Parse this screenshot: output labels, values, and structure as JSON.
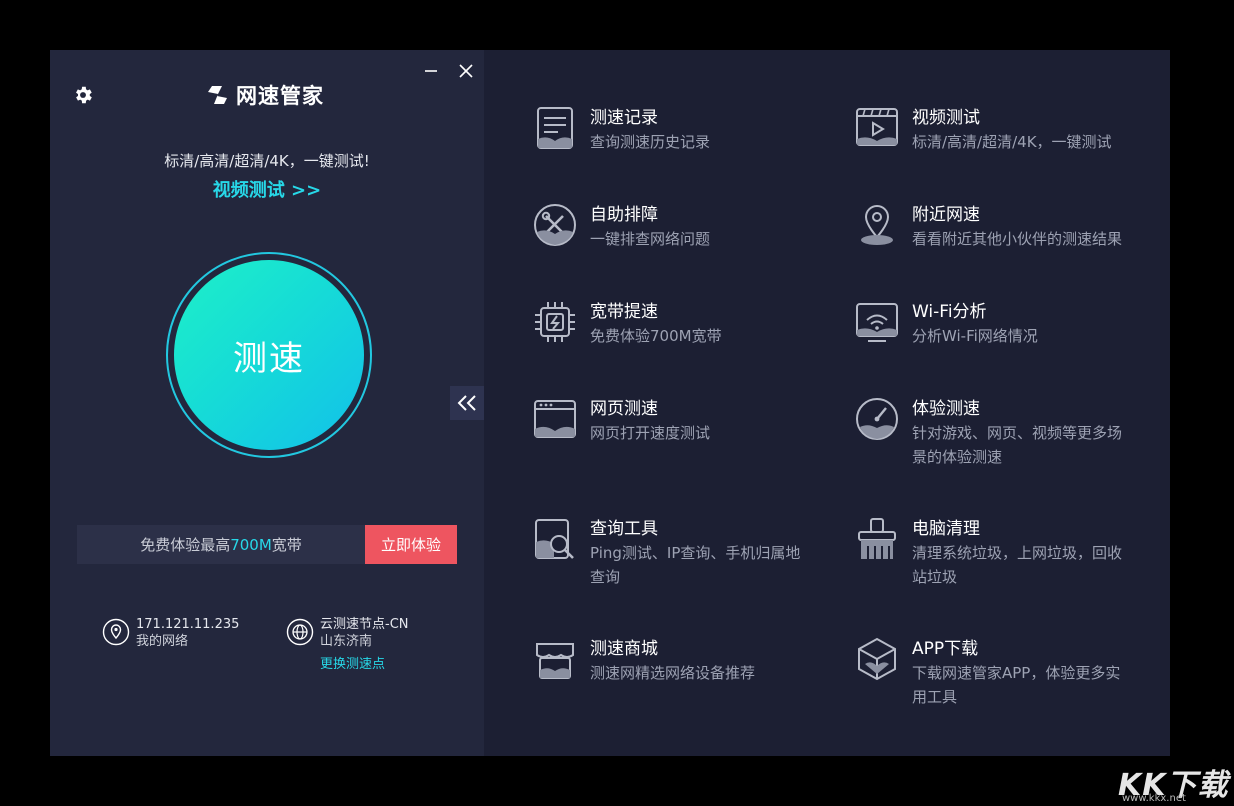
{
  "app": {
    "title": "网速管家"
  },
  "left": {
    "promo_line": "标清/高清/超清/4K，一键测试!",
    "promo_link": "视频测试 >>",
    "speed_button": "测速",
    "broadband": {
      "text_before": "免费体验最高",
      "text_highlight": "700M",
      "text_after": "宽带",
      "button": "立即体验"
    },
    "network": {
      "ip": "171.121.11.235",
      "label": "我的网络"
    },
    "node": {
      "name": "云测速节点-CN",
      "location": "山东济南",
      "change_link": "更换测速点"
    }
  },
  "features": [
    {
      "title": "测速记录",
      "desc": "查询测速历史记录",
      "icon": "record-icon"
    },
    {
      "title": "视频测试",
      "desc": "标清/高清/超清/4K，一键测试",
      "icon": "video-icon"
    },
    {
      "title": "自助排障",
      "desc": "一键排查网络问题",
      "icon": "repair-icon"
    },
    {
      "title": "附近网速",
      "desc": "看看附近其他小伙伴的测速结果",
      "icon": "location-icon"
    },
    {
      "title": "宽带提速",
      "desc": "免费体验700M宽带",
      "icon": "chip-icon"
    },
    {
      "title": "Wi-Fi分析",
      "desc": "分析Wi-Fi网络情况",
      "icon": "wifi-icon"
    },
    {
      "title": "网页测速",
      "desc": "网页打开速度测试",
      "icon": "webpage-icon"
    },
    {
      "title": "体验测速",
      "desc": "针对游戏、网页、视频等更多场景的体验测速",
      "icon": "gauge-icon"
    },
    {
      "title": "查询工具",
      "desc": "Ping测试、IP查询、手机归属地查询",
      "icon": "search-tool-icon"
    },
    {
      "title": "电脑清理",
      "desc": "清理系统垃圾，上网垃圾，回收站垃圾",
      "icon": "broom-icon"
    },
    {
      "title": "测速商城",
      "desc": "测速网精选网络设备推荐",
      "icon": "store-icon"
    },
    {
      "title": "APP下载",
      "desc": "下载网速管家APP，体验更多实用工具",
      "icon": "app-download-icon"
    }
  ],
  "watermark": {
    "big": "KK下载",
    "small": "www.kkx.net"
  },
  "colors": {
    "accent": "#27d8e8",
    "cta": "#ee5560",
    "dial_start": "#1ef0c8",
    "dial_end": "#12c0ea"
  }
}
